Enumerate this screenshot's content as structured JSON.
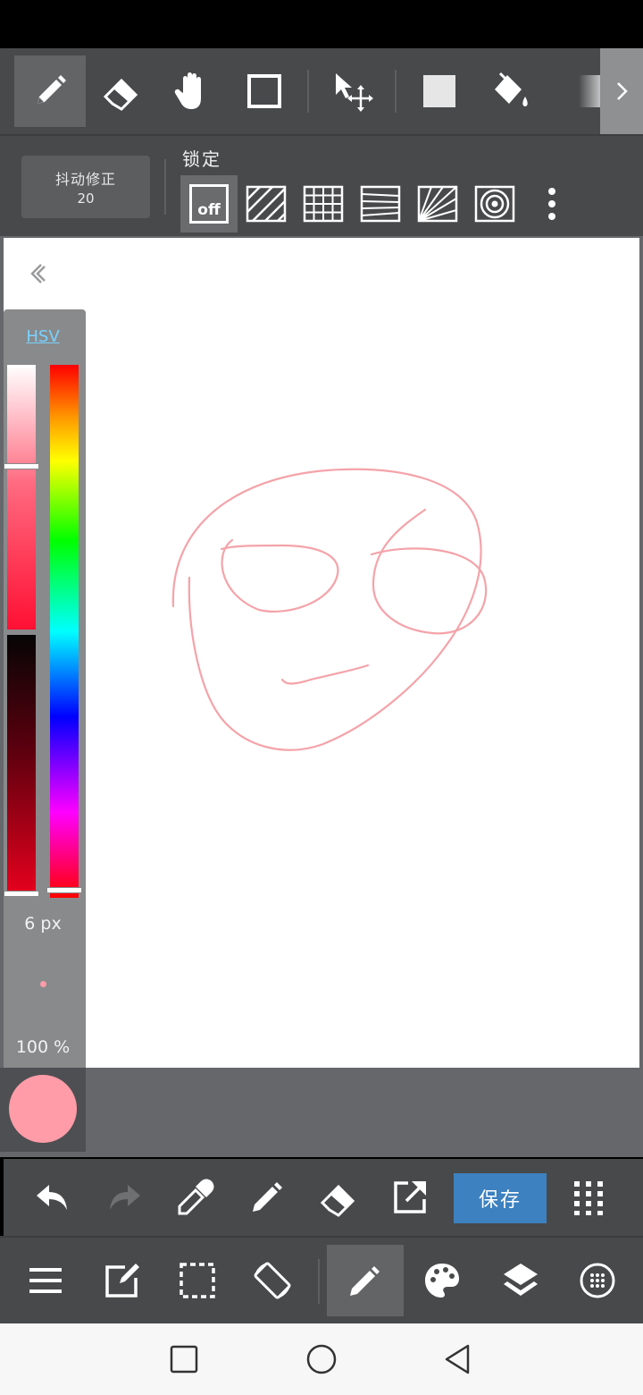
{
  "tools": {
    "pen": "pen",
    "eraser": "eraser",
    "hand": "hand",
    "shape": "shape",
    "move": "move",
    "fill_color": "fill-color",
    "bucket": "bucket",
    "gradient": "gradient",
    "more": "more-tools"
  },
  "options": {
    "stabilizer_label": "抖动修正",
    "stabilizer_value": "20",
    "lock_title": "锁定",
    "ruler_off": "off"
  },
  "color_panel": {
    "mode_tab": "HSV",
    "brush_size": "6 px",
    "opacity": "100 %",
    "current_color": "#ff9ca8",
    "stroke_color": "#f4a3a9"
  },
  "bottom_bar": {
    "save_label": "保存"
  }
}
